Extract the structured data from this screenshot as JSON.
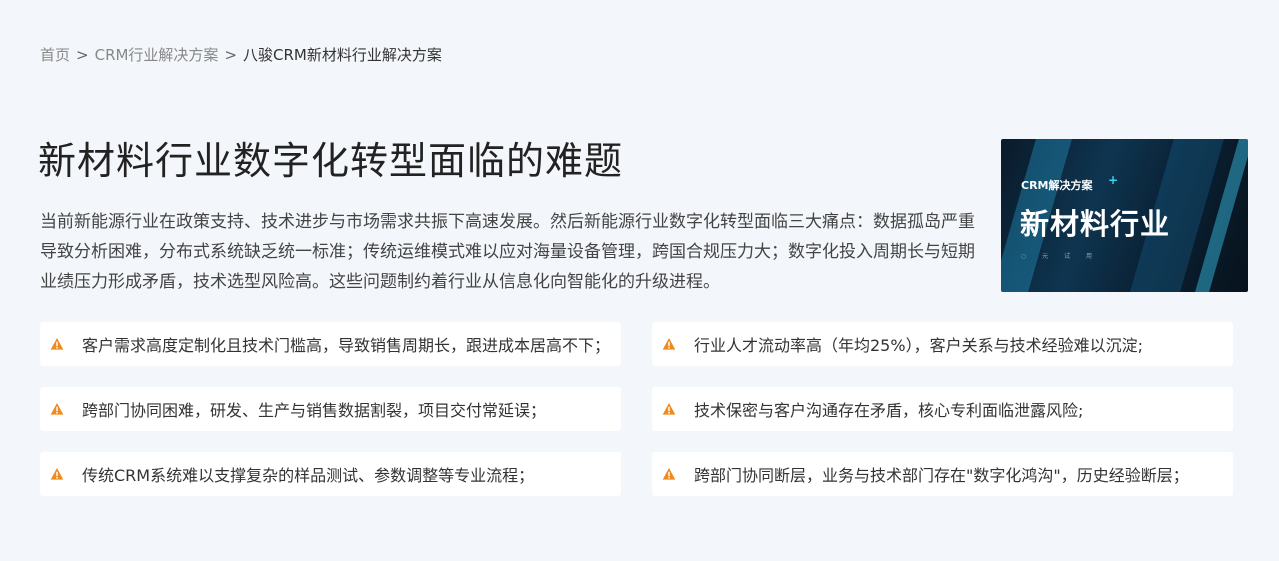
{
  "breadcrumb": {
    "home": "首页",
    "separator": ">",
    "category": "CRM行业解决方案",
    "current": "八骏CRM新材料行业解决方案"
  },
  "title": "新材料行业数字化转型面临的难题",
  "description": "当前新能源行业在政策支持、技术进步与市场需求共振下高速发展。然后新能源行业数字化转型面临三大痛点：数据孤岛严重导致分析困难，分布式系统缺乏统一标准；传统运维模式难以应对海量设备管理，跨国合规压力大；数字化投入周期长与短期业绩压力形成矛盾，技术选型风险高。这些问题制约着行业从信息化向智能化的升级进程。",
  "banner": {
    "subtitle": "CRM解决方案",
    "plus": "+",
    "heading": "新材料行业",
    "small_caption": "○ 元 试 用"
  },
  "colors": {
    "warning_icon": "#f08a1c",
    "background": "#f3f6fa",
    "card": "#ffffff"
  },
  "problems": [
    {
      "icon": "warning-icon",
      "text": "客户需求高度定制化且技术门槛高，导致销售周期长，跟进成本居高不下；"
    },
    {
      "icon": "warning-icon",
      "text": "行业人才流动率高（年均25%），客户关系与技术经验难以沉淀;"
    },
    {
      "icon": "warning-icon",
      "text": "跨部门协同困难，研发、生产与销售数据割裂，项目交付常延误；"
    },
    {
      "icon": "warning-icon",
      "text": "技术保密与客户沟通存在矛盾，核心专利面临泄露风险;"
    },
    {
      "icon": "warning-icon",
      "text": "传统CRM系统难以支撑复杂的样品测试、参数调整等专业流程；"
    },
    {
      "icon": "warning-icon",
      "text": "跨部门协同断层，业务与技术部门存在\"数字化鸿沟\"，历史经验断层；"
    }
  ]
}
